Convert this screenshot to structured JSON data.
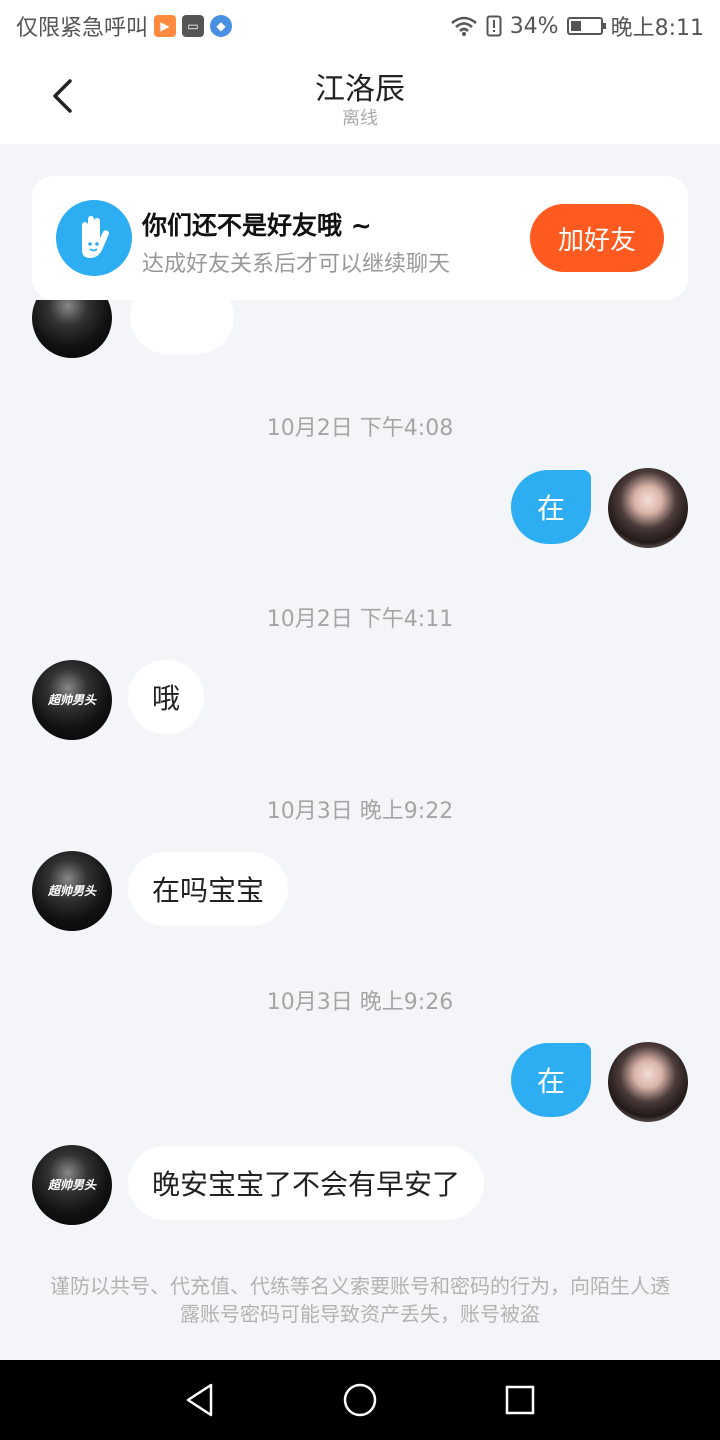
{
  "status_bar": {
    "carrier_text": "仅限紧急呼叫",
    "battery": "34%",
    "time": "晚上8:11"
  },
  "header": {
    "title": "江洛辰",
    "subtitle": "离线"
  },
  "friend_prompt": {
    "title": "你们还不是好友哦 ~",
    "subtitle": "达成好友关系后才可以继续聊天",
    "button": "加好友"
  },
  "peer_avatar_text": "超帅男头",
  "messages": [
    {
      "timestamp": "10月2日 下午4:08",
      "sender": "me",
      "text": "在"
    },
    {
      "timestamp": "10月2日 下午4:11",
      "sender": "peer",
      "text": "哦"
    },
    {
      "timestamp": "10月3日 晚上9:22",
      "sender": "peer",
      "text": "在吗宝宝"
    },
    {
      "timestamp": "10月3日 晚上9:26",
      "sender": "me",
      "text": "在"
    },
    {
      "timestamp": "",
      "sender": "peer",
      "text": "晚安宝宝了不会有早安了"
    }
  ],
  "notice": "谨防以共号、代充值、代练等名义索要账号和密码的行为，向陌生人透露账号密码可能导致资产丢失，账号被盗",
  "colors": {
    "accent_blue": "#2eaef2",
    "add_friend_orange": "#ff5a1f",
    "background": "#f3f5f8"
  }
}
